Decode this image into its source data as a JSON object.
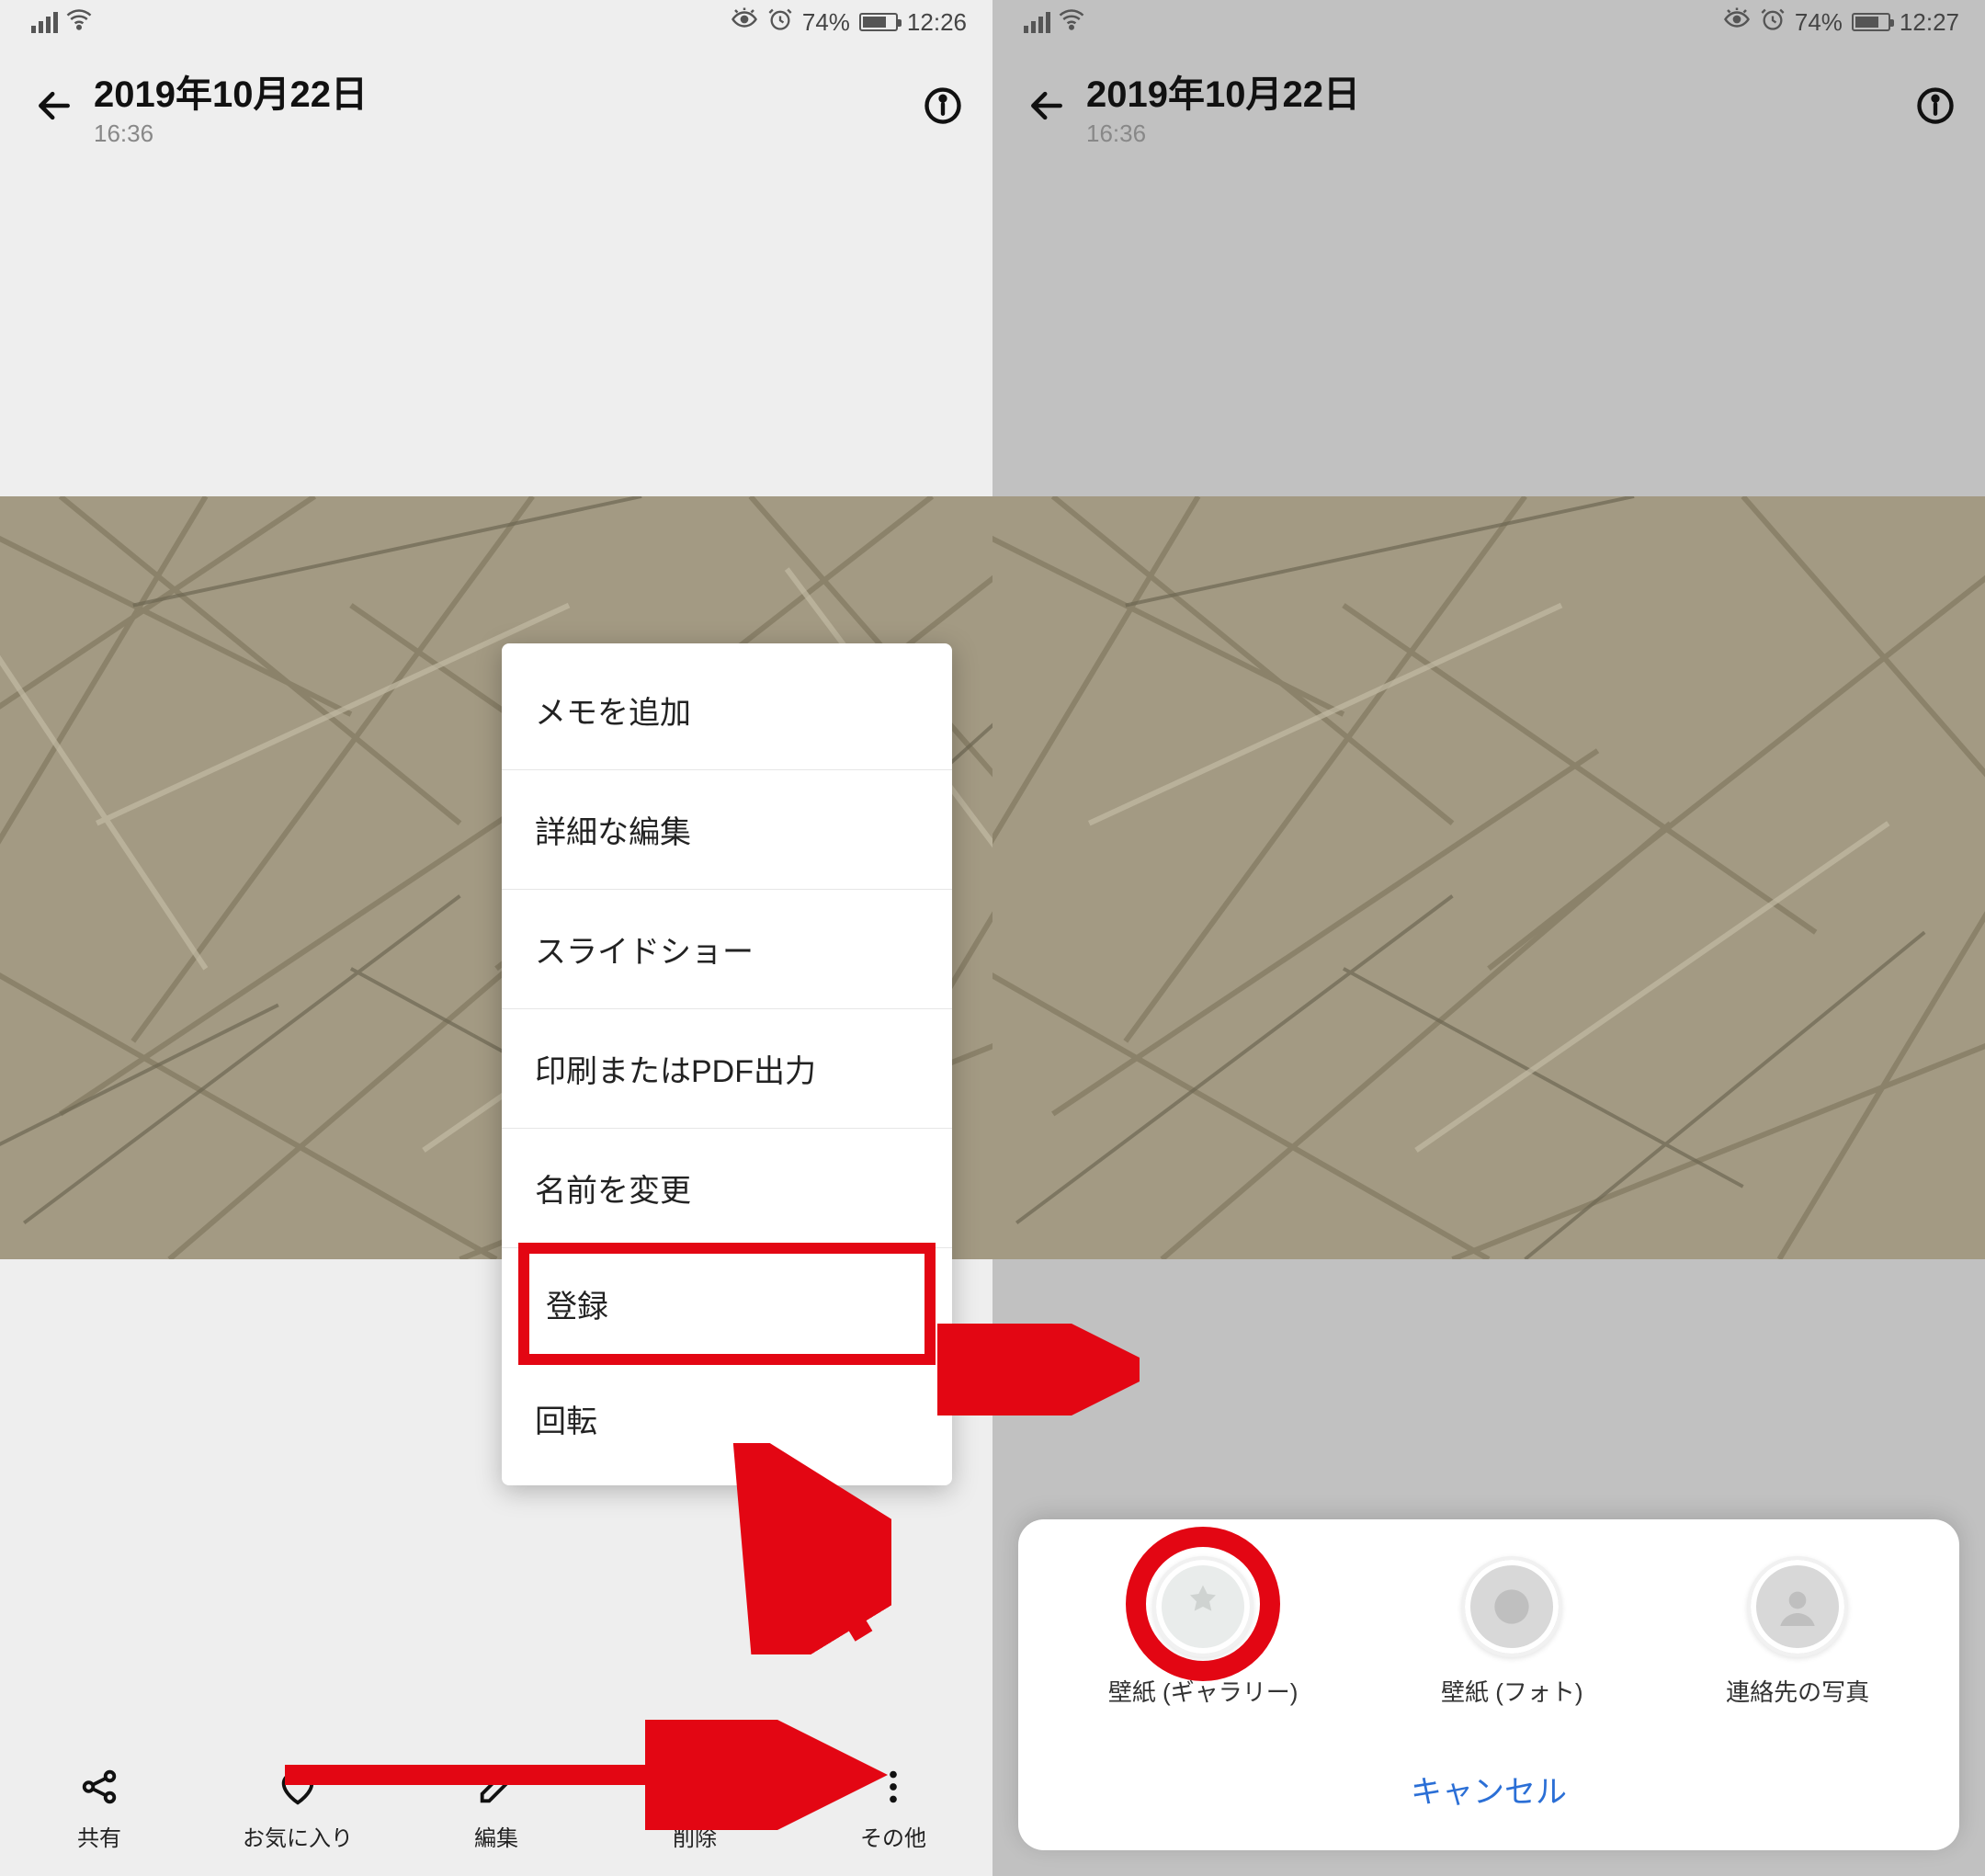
{
  "status": {
    "battery_pct": "74%",
    "time_left": "12:26",
    "time_right": "12:27"
  },
  "header": {
    "title": "2019年10月22日",
    "subtitle": "16:36"
  },
  "toolbar": {
    "share": "共有",
    "favorite": "お気に入り",
    "edit": "編集",
    "delete": "削除",
    "more": "その他"
  },
  "menu": {
    "add_memo": "メモを追加",
    "advanced_edit": "詳細な編集",
    "slideshow": "スライドショー",
    "print_pdf": "印刷またはPDF出力",
    "rename": "名前を変更",
    "register": "登録",
    "rotate": "回転"
  },
  "sheet": {
    "wallpaper_gallery": "壁紙 (ギャラリー)",
    "wallpaper_photo": "壁紙 (フォト)",
    "contact_photo": "連絡先の写真",
    "cancel": "キャンセル"
  }
}
